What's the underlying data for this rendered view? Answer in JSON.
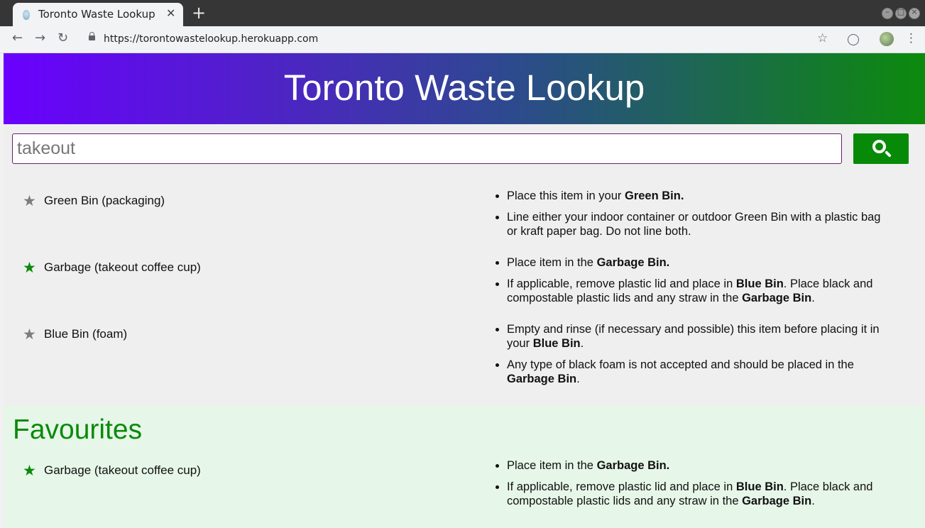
{
  "browser": {
    "tab_title": "Toronto Waste Lookup",
    "tab_close": "✕",
    "new_tab": "+",
    "url": "https://torontowastelookup.herokuapp.com",
    "back": "←",
    "forward": "→",
    "reload": "↻",
    "bookmark": "☆",
    "menu": "⋮"
  },
  "header": {
    "title": "Toronto Waste Lookup"
  },
  "search": {
    "value": "takeout",
    "button_icon": "search-icon"
  },
  "results": [
    {
      "name": "Green Bin (packaging)",
      "favourited": false,
      "instructions": [
        [
          {
            "t": "Place this item in your "
          },
          {
            "t": "Green Bin.",
            "b": true
          }
        ],
        [
          {
            "t": "Line either your indoor container or outdoor Green Bin with a plastic bag or kraft paper bag. Do not line both."
          }
        ]
      ]
    },
    {
      "name": "Garbage (takeout coffee cup)",
      "favourited": true,
      "instructions": [
        [
          {
            "t": "Place item in the "
          },
          {
            "t": "Garbage Bin.",
            "b": true
          }
        ],
        [
          {
            "t": "If applicable, remove plastic lid and place in "
          },
          {
            "t": "Blue Bin",
            "b": true
          },
          {
            "t": ". Place black and compostable plastic lids and any straw in the "
          },
          {
            "t": "Garbage Bin",
            "b": true
          },
          {
            "t": "."
          }
        ]
      ]
    },
    {
      "name": "Blue Bin (foam)",
      "favourited": false,
      "instructions": [
        [
          {
            "t": "Empty and rinse (if necessary and possible) this item before placing it in your "
          },
          {
            "t": "Blue Bin",
            "b": true
          },
          {
            "t": "."
          }
        ],
        [
          {
            "t": "Any type of black foam is not accepted and should be placed in the "
          },
          {
            "t": "Garbage Bin",
            "b": true
          },
          {
            "t": "."
          }
        ]
      ]
    }
  ],
  "favourites": {
    "title": "Favourites",
    "items": [
      {
        "name": "Garbage (takeout coffee cup)",
        "favourited": true,
        "instructions": [
          [
            {
              "t": "Place item in the "
            },
            {
              "t": "Garbage Bin.",
              "b": true
            }
          ],
          [
            {
              "t": "If applicable, remove plastic lid and place in "
            },
            {
              "t": "Blue Bin",
              "b": true
            },
            {
              "t": ". Place black and compostable plastic lids and any straw in the "
            },
            {
              "t": "Garbage Bin",
              "b": true
            },
            {
              "t": "."
            }
          ]
        ]
      }
    ]
  },
  "colors": {
    "brand_green": "#078a08",
    "star_inactive": "#7d7d7d",
    "favourites_bg": "#e6f6e8"
  }
}
